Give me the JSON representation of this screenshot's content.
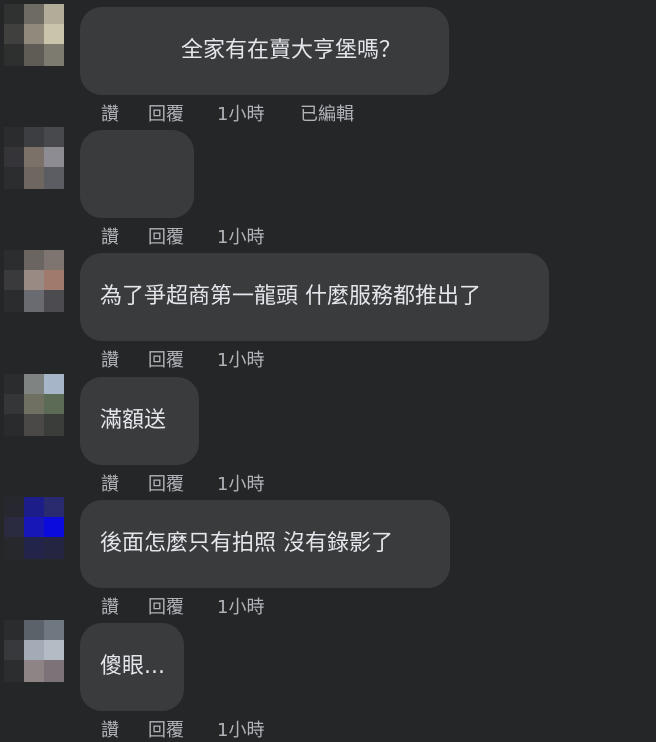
{
  "comments": [
    {
      "text": "全家有在賣大亨堡嗎？",
      "like": "讚",
      "reply": "回覆",
      "time": "1小時",
      "edited": "已編輯"
    },
    {
      "text": "",
      "like": "讚",
      "reply": "回覆",
      "time": "1小時"
    },
    {
      "text": "為了爭超商第一龍頭 什麼服務都推出了",
      "like": "讚",
      "reply": "回覆",
      "time": "1小時"
    },
    {
      "text": "滿額送",
      "like": "讚",
      "reply": "回覆",
      "time": "1小時"
    },
    {
      "text": "後面怎麼只有拍照 沒有錄影了",
      "like": "讚",
      "reply": "回覆",
      "time": "1小時"
    },
    {
      "text": "傻眼...",
      "like": "讚",
      "reply": "回覆",
      "time": "1小時"
    }
  ]
}
